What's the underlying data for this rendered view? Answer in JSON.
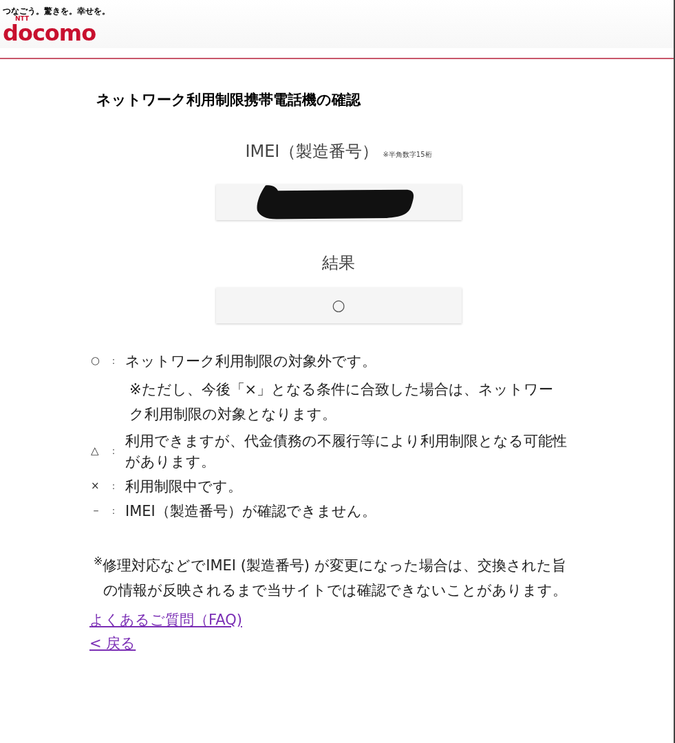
{
  "header": {
    "tagline": "つなごう。驚きを。幸せを。",
    "logo_mark": "NTT",
    "logo": "docomo"
  },
  "title": "ネットワーク利用制限携帯電話機の確認",
  "imei": {
    "label": "IMEI（製造番号）",
    "hint": "※半角数字15桁",
    "redacted": true
  },
  "result": {
    "label": "結果",
    "value": "○"
  },
  "legend": [
    {
      "symbol": "○",
      "separator": "：",
      "text": "ネットワーク利用制限の対象外です。",
      "note": "※ただし、今後「×」となる条件に合致した場合は、ネットワーク利用制限の対象となります。"
    },
    {
      "symbol": "△",
      "separator": "：",
      "text": "利用できますが、代金債務の不履行等により利用制限となる可能性があります。"
    },
    {
      "symbol": "×",
      "separator": "：",
      "text": "利用制限中です。"
    },
    {
      "symbol": "－",
      "separator": "：",
      "text": "IMEI（製造番号）が確認できません。"
    }
  ],
  "footnote": "$^{※}$修理対応などでIMEI (製造番号) が変更になった場合は、交換された旨の情報が反映されるまで当サイトでは確認できないことがあります。",
  "links": [
    "よくあるご質問（FAQ)",
    "< 戻る"
  ]
}
